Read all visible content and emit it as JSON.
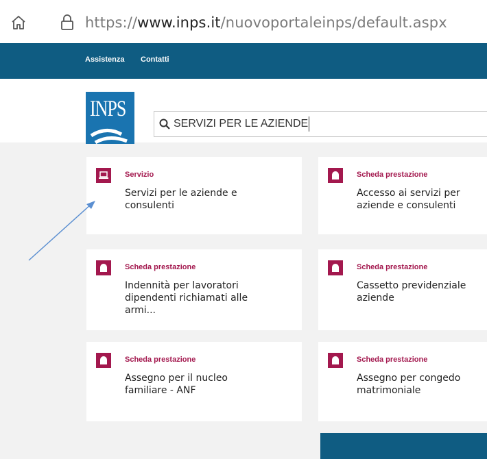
{
  "browser": {
    "url_prefix": "https://",
    "url_host": "www.inps.it",
    "url_path": "/nuovoportaleinps/default.aspx"
  },
  "nav": {
    "items": [
      {
        "label": "Assistenza"
      },
      {
        "label": "Contatti"
      }
    ]
  },
  "header": {
    "logo_text": "INPS",
    "search": {
      "value": "SERVIZI PER LE AZIENDE"
    }
  },
  "results": [
    {
      "type": "Servizio",
      "title": "Servizi per le aziende e consulenti",
      "icon": "laptop-icon"
    },
    {
      "type": "Scheda prestazione",
      "title": "Accesso ai servizi per aziende e consulenti",
      "icon": "document-icon"
    },
    {
      "type": "Scheda prestazione",
      "title": "Indennità per lavoratori dipendenti richiamati alle armi...",
      "icon": "document-icon"
    },
    {
      "type": "Scheda prestazione",
      "title": "Cassetto previdenziale aziende",
      "icon": "document-icon"
    },
    {
      "type": "Scheda prestazione",
      "title": "Assegno per il nucleo familiare - ANF",
      "icon": "document-icon"
    },
    {
      "type": "Scheda prestazione",
      "title": "Assegno per congedo matrimoniale",
      "icon": "document-icon"
    }
  ],
  "colors": {
    "nav_blue": "#0f5c82",
    "logo_blue": "#1a74b0",
    "accent_magenta": "#a3184e",
    "annotation_arrow": "#5b8fd1"
  }
}
